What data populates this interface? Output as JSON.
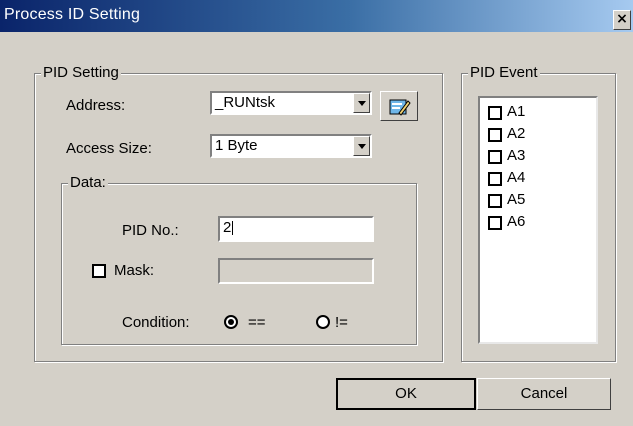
{
  "window": {
    "title": "Process ID Setting",
    "close_glyph": "×"
  },
  "pid_setting": {
    "group_label": "PID Setting",
    "address_label": "Address:",
    "address_value": "_RUNtsk",
    "access_size_label": "Access Size:",
    "access_size_value": "1 Byte",
    "browse_icon": "symbol-browse-icon",
    "data": {
      "group_label": "Data:",
      "pid_no_label": "PID No.:",
      "pid_no_value": "2",
      "mask_label": "Mask:",
      "mask_checked": false,
      "mask_value": "",
      "condition_label": "Condition:",
      "condition_options": [
        "==",
        "!="
      ],
      "condition_selected": "=="
    }
  },
  "pid_event": {
    "group_label": "PID Event",
    "items": [
      {
        "label": "A1",
        "checked": false
      },
      {
        "label": "A2",
        "checked": false
      },
      {
        "label": "A3",
        "checked": false
      },
      {
        "label": "A4",
        "checked": false
      },
      {
        "label": "A5",
        "checked": false
      },
      {
        "label": "A6",
        "checked": false
      }
    ]
  },
  "buttons": {
    "ok": "OK",
    "cancel": "Cancel"
  },
  "colors": {
    "title_start": "#0a246a",
    "title_end": "#a6caf0",
    "face": "#d4d0c8"
  }
}
